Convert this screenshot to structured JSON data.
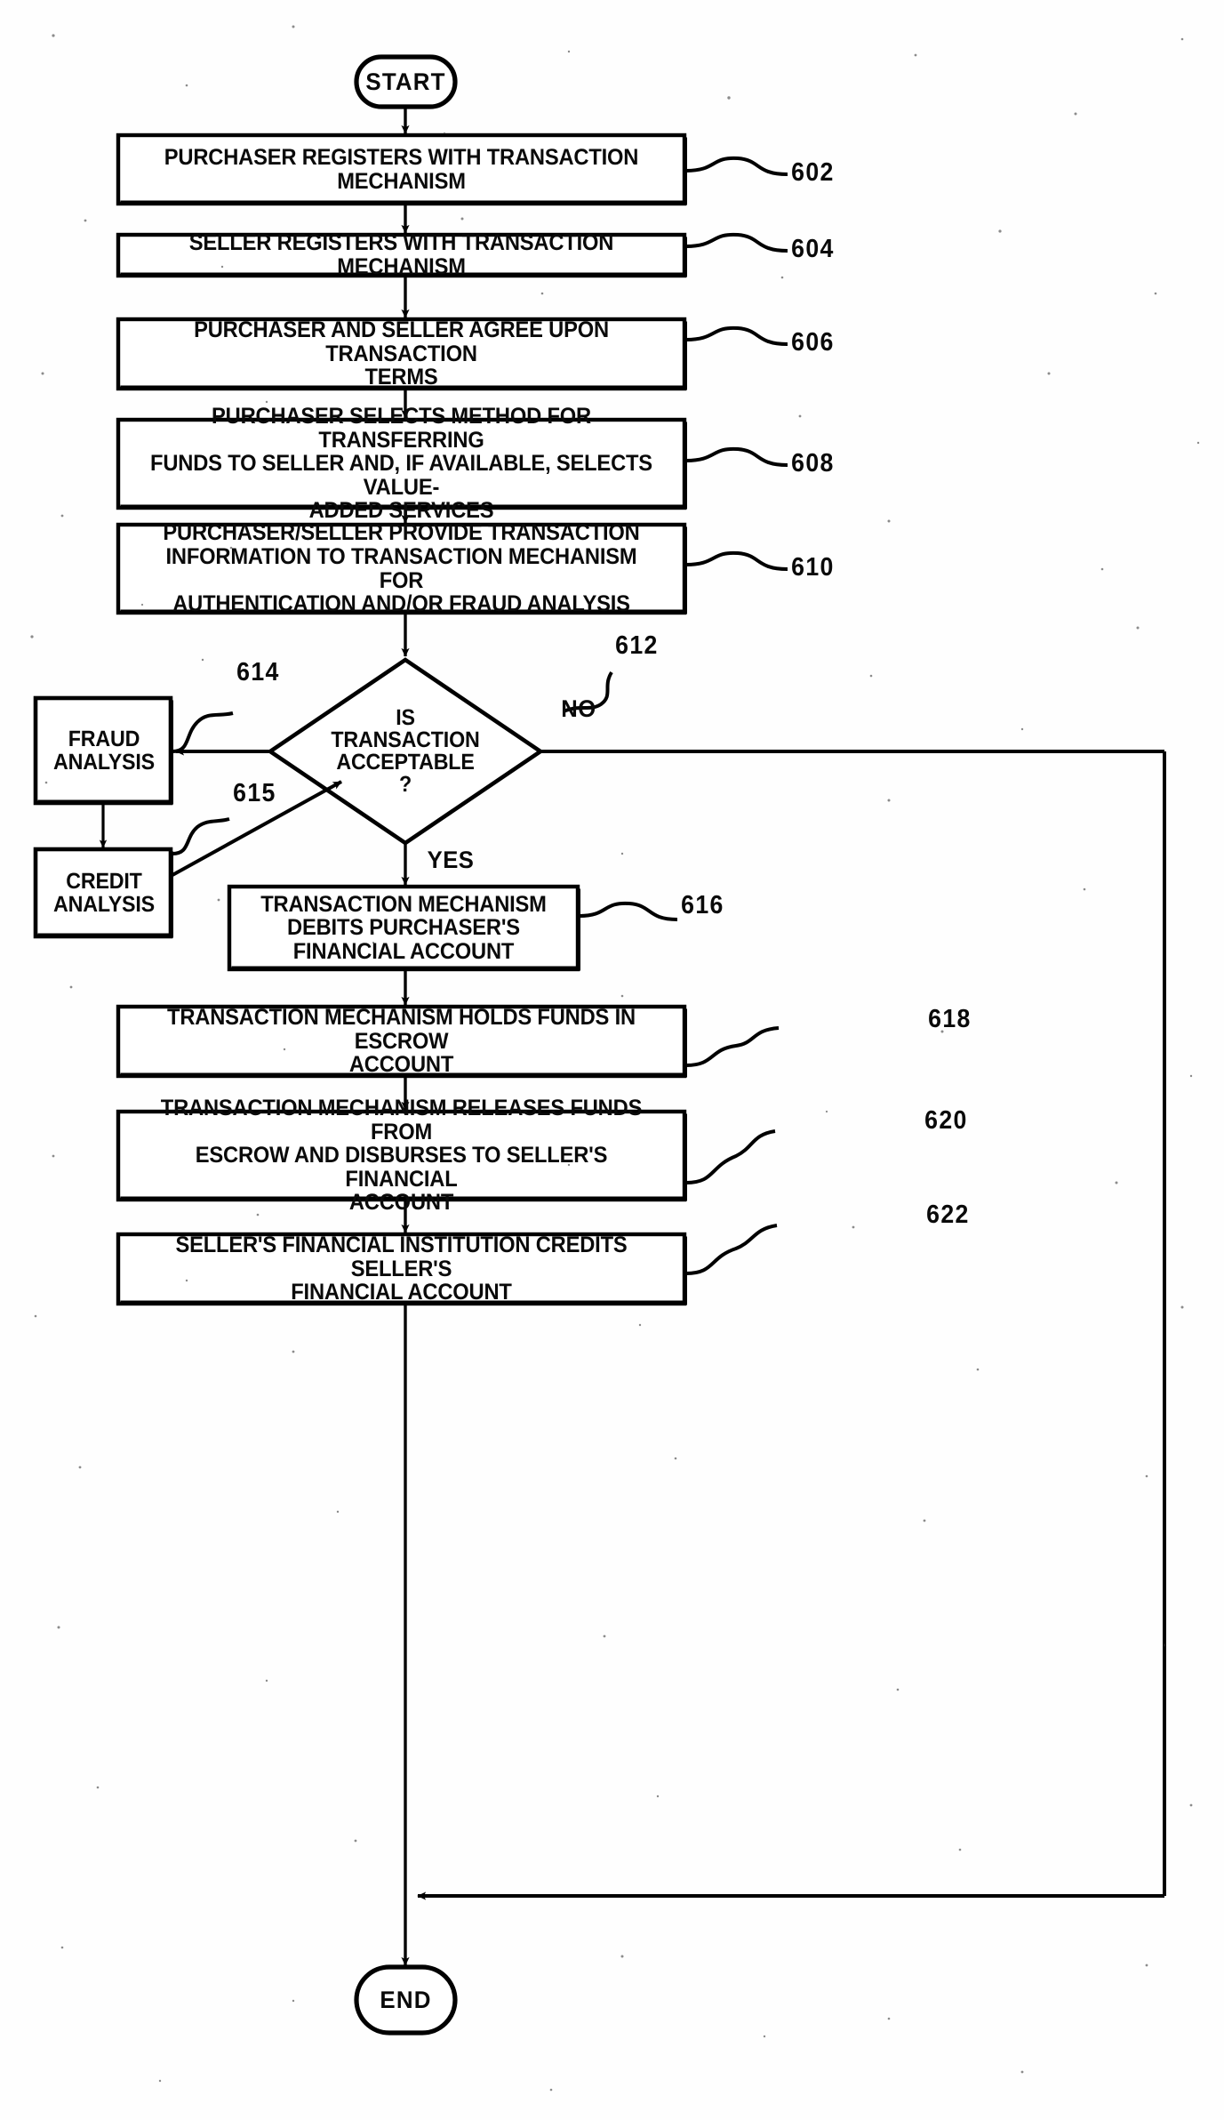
{
  "figure": {
    "type": "patent-flowchart",
    "orientation": "vertical",
    "background_color": "#ffffff",
    "line_color": "#000000"
  },
  "terminators": {
    "start": "START",
    "end": "END"
  },
  "branch_labels": {
    "no": "NO",
    "yes": "YES"
  },
  "decision": {
    "ref": "612",
    "text": "IS\nTRANSACTION\nACCEPTABLE\n?"
  },
  "side_nodes": [
    {
      "ref": "614",
      "text": "FRAUD\nANALYSIS"
    },
    {
      "ref": "615",
      "text": "CREDIT\nANALYSIS"
    }
  ],
  "steps": [
    {
      "ref": "602",
      "text": "PURCHASER REGISTERS WITH TRANSACTION\nMECHANISM"
    },
    {
      "ref": "604",
      "text": "SELLER REGISTERS WITH TRANSACTION MECHANISM"
    },
    {
      "ref": "606",
      "text": "PURCHASER AND SELLER AGREE UPON TRANSACTION\nTERMS"
    },
    {
      "ref": "608",
      "text": "PURCHASER SELECTS METHOD FOR TRANSFERRING\nFUNDS TO SELLER AND, IF AVAILABLE, SELECTS VALUE-\nADDED SERVICES"
    },
    {
      "ref": "610",
      "text": "PURCHASER/SELLER PROVIDE TRANSACTION\nINFORMATION TO TRANSACTION MECHANISM FOR\nAUTHENTICATION AND/OR FRAUD ANALYSIS"
    },
    {
      "ref": "616",
      "text": "TRANSACTION MECHANISM\nDEBITS PURCHASER'S\nFINANCIAL ACCOUNT"
    },
    {
      "ref": "618",
      "text": "TRANSACTION MECHANISM HOLDS FUNDS IN ESCROW\nACCOUNT"
    },
    {
      "ref": "620",
      "text": "TRANSACTION MECHANISM RELEASES FUNDS FROM\nESCROW AND DISBURSES TO SELLER'S FINANCIAL\nACCOUNT"
    },
    {
      "ref": "622",
      "text": "SELLER'S FINANCIAL INSTITUTION CREDITS SELLER'S\nFINANCIAL ACCOUNT"
    }
  ]
}
